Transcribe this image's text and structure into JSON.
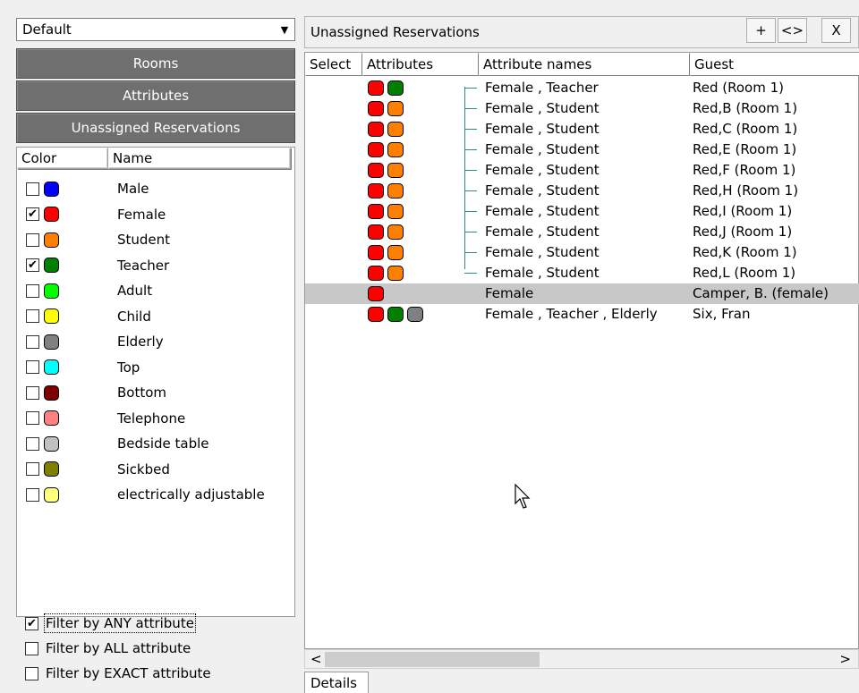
{
  "left": {
    "combo_value": "Default",
    "sections": [
      "Rooms",
      "Attributes",
      "Unassigned Reservations"
    ],
    "list_headers": {
      "color": "Color",
      "name": "Name"
    },
    "attributes": [
      {
        "name": "Male",
        "checked": false,
        "color": "#0000ff"
      },
      {
        "name": "Female",
        "checked": true,
        "color": "#ff0000"
      },
      {
        "name": "Student",
        "checked": false,
        "color": "#ff8000"
      },
      {
        "name": "Teacher",
        "checked": true,
        "color": "#008000"
      },
      {
        "name": "Adult",
        "checked": false,
        "color": "#00ff00"
      },
      {
        "name": "Child",
        "checked": false,
        "color": "#ffff00"
      },
      {
        "name": "Elderly",
        "checked": false,
        "color": "#808080"
      },
      {
        "name": "Top",
        "checked": false,
        "color": "#00ffff"
      },
      {
        "name": "Bottom",
        "checked": false,
        "color": "#800000"
      },
      {
        "name": "Telephone",
        "checked": false,
        "color": "#ff8080"
      },
      {
        "name": "Bedside table",
        "checked": false,
        "color": "#c0c0c0"
      },
      {
        "name": "Sickbed",
        "checked": false,
        "color": "#808000"
      },
      {
        "name": "electrically adjustable",
        "checked": false,
        "color": "#ffff80"
      }
    ],
    "filters": [
      {
        "label": "Filter by ANY attribute",
        "checked": true
      },
      {
        "label": "Filter by ALL attribute",
        "checked": false
      },
      {
        "label": "Filter by EXACT attribute",
        "checked": false
      }
    ]
  },
  "right": {
    "title": "Unassigned Reservations",
    "buttons": {
      "add": "+",
      "toggle": "<>",
      "close": "X"
    },
    "columns": {
      "select": "Select",
      "attributes": "Attributes",
      "attribute_names": "Attribute names",
      "guest": "Guest"
    },
    "reservations": [
      {
        "colors": [
          "#ff0000",
          "#008000"
        ],
        "names": "Female , Teacher",
        "guest": "Red (Room 1)",
        "tree": true
      },
      {
        "colors": [
          "#ff0000",
          "#ff8000"
        ],
        "names": "Female , Student",
        "guest": "Red,B (Room 1)",
        "tree": true
      },
      {
        "colors": [
          "#ff0000",
          "#ff8000"
        ],
        "names": "Female , Student",
        "guest": "Red,C (Room 1)",
        "tree": true
      },
      {
        "colors": [
          "#ff0000",
          "#ff8000"
        ],
        "names": "Female , Student",
        "guest": "Red,E (Room 1)",
        "tree": true
      },
      {
        "colors": [
          "#ff0000",
          "#ff8000"
        ],
        "names": "Female , Student",
        "guest": "Red,F (Room 1)",
        "tree": true
      },
      {
        "colors": [
          "#ff0000",
          "#ff8000"
        ],
        "names": "Female , Student",
        "guest": "Red,H (Room 1)",
        "tree": true
      },
      {
        "colors": [
          "#ff0000",
          "#ff8000"
        ],
        "names": "Female , Student",
        "guest": "Red,I (Room 1)",
        "tree": true
      },
      {
        "colors": [
          "#ff0000",
          "#ff8000"
        ],
        "names": "Female , Student",
        "guest": "Red,J (Room 1)",
        "tree": true
      },
      {
        "colors": [
          "#ff0000",
          "#ff8000"
        ],
        "names": "Female , Student",
        "guest": "Red,K (Room 1)",
        "tree": true
      },
      {
        "colors": [
          "#ff0000",
          "#ff8000"
        ],
        "names": "Female , Student",
        "guest": "Red,L (Room 1)",
        "tree": true
      },
      {
        "colors": [
          "#ff0000"
        ],
        "names": "Female",
        "guest": "Camper, B. (female)",
        "tree": false,
        "selected": true
      },
      {
        "colors": [
          "#ff0000",
          "#008000",
          "#808080"
        ],
        "names": "Female , Teacher , Elderly",
        "guest": "Six, Fran",
        "tree": false
      }
    ],
    "scroll": {
      "left_arrow": "<",
      "right_arrow": ">"
    },
    "bottom_tab": "Details"
  }
}
